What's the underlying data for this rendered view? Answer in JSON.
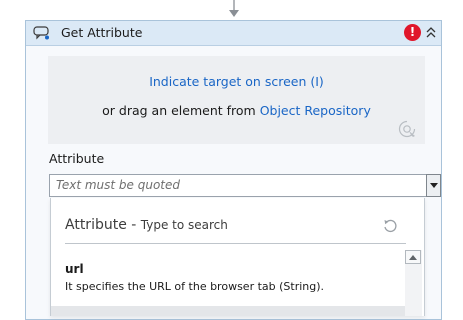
{
  "activity": {
    "title": "Get Attribute",
    "error_badge": "!",
    "icons": {
      "activity": "get-attribute-icon",
      "error": "error-icon",
      "collapse": "chevron-double-up-icon"
    }
  },
  "target": {
    "indicate_link": "Indicate target on screen (I)",
    "drag_prefix": "or drag an element from ",
    "repository_link": "Object Repository",
    "icon": "target-selector-icon"
  },
  "attribute_field": {
    "label": "Attribute",
    "placeholder": "Text must be quoted",
    "dropdown_icon": "dropdown-arrow-icon"
  },
  "suggestions": {
    "heading": "Attribute",
    "dash": " - ",
    "hint": "Type to search",
    "refresh_icon": "refresh-icon",
    "items": [
      {
        "name": "url",
        "description": "It specifies the URL of the browser tab (String)."
      }
    ]
  },
  "colors": {
    "header_bg": "#dbe9f6",
    "link": "#1a66c6",
    "error": "#e0162b"
  }
}
